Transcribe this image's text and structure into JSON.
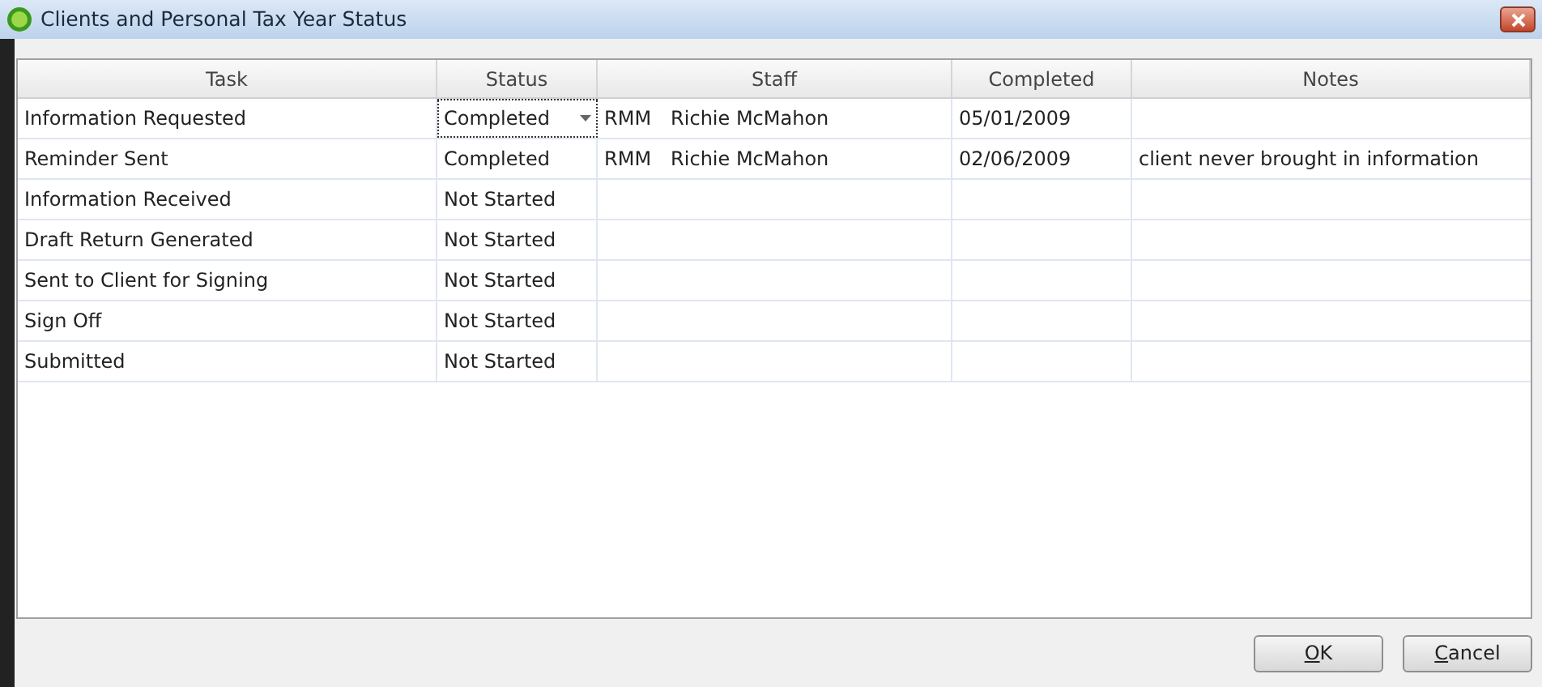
{
  "window": {
    "title": "Clients and Personal Tax Year Status"
  },
  "table": {
    "columns": [
      "Task",
      "Status",
      "Staff",
      "Completed",
      "Notes"
    ],
    "rows": [
      {
        "task": "Information Requested",
        "status": "Completed",
        "status_editing": true,
        "staff_code": "RMM",
        "staff_name": "Richie McMahon",
        "completed": "05/01/2009",
        "notes": ""
      },
      {
        "task": "Reminder Sent",
        "status": "Completed",
        "status_editing": false,
        "staff_code": "RMM",
        "staff_name": "Richie McMahon",
        "completed": "02/06/2009",
        "notes": "client never brought in information"
      },
      {
        "task": "Information Received",
        "status": "Not Started",
        "status_editing": false
      },
      {
        "task": "Draft Return Generated",
        "status": "Not Started",
        "status_editing": false
      },
      {
        "task": "Sent to Client for Signing",
        "status": "Not Started",
        "status_editing": false
      },
      {
        "task": "Sign Off",
        "status": "Not Started",
        "status_editing": false
      },
      {
        "task": "Submitted",
        "status": "Not Started",
        "status_editing": false
      }
    ]
  },
  "buttons": [
    "OK",
    "Cancel"
  ]
}
